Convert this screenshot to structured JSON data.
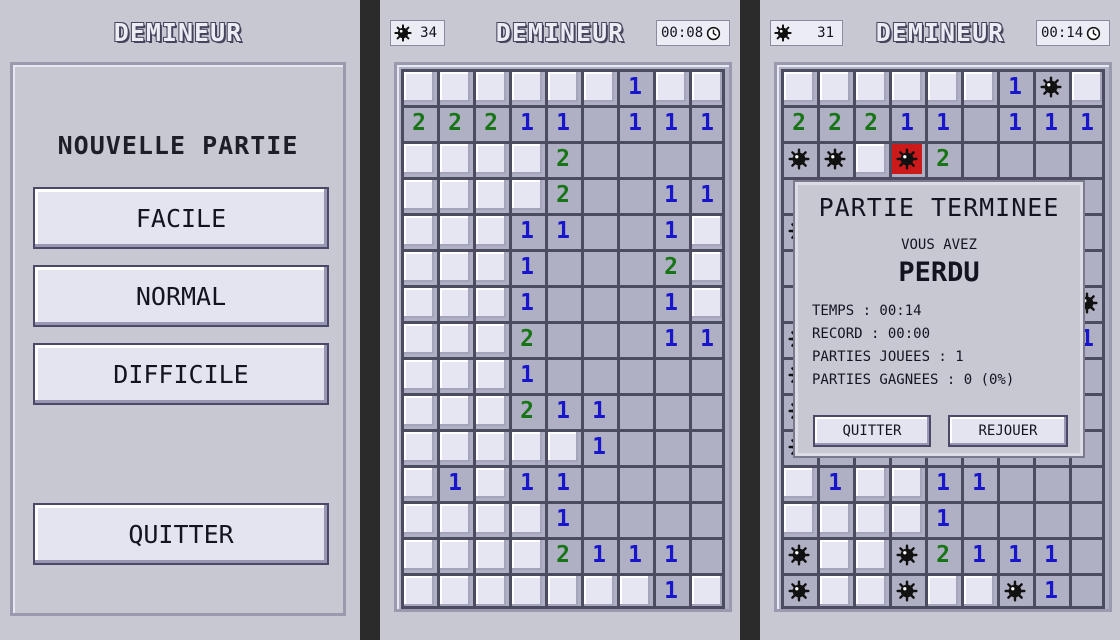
{
  "game_title": "DEMINEUR",
  "menu": {
    "heading": "NOUVELLE PARTIE",
    "buttons": [
      "FACILE",
      "NORMAL",
      "DIFFICILE"
    ],
    "quit": "QUITTER"
  },
  "game1": {
    "mines_left": "34",
    "timer": "00:08",
    "rows": [
      "HHHHHH1HH",
      "22211 111",
      "HHHH2    ",
      "HHHH2  11",
      "HHH11  1H",
      "HHH1   2H",
      "HHH1   1H",
      "HHH2   11",
      "HHH1     ",
      "HHH211   ",
      "HHHHH1   ",
      "H1H11    ",
      "HHHH1    ",
      "HHHH2111 ",
      "HHHHHHH1H"
    ]
  },
  "game2": {
    "mines_left": "31",
    "timer": "00:14",
    "rows": [
      "HHHHHH1MH",
      "22211 111",
      "MMHX2    ",
      "         ",
      "M        ",
      "         ",
      "        M",
      "M       1",
      "M        ",
      "M        ",
      "M        ",
      "H1HH11   ",
      "HHHH1    ",
      "MHHM2111 ",
      "MHHMHHM1 "
    ]
  },
  "dialog": {
    "title": "PARTIE TERMINEE",
    "subtitle": "VOUS AVEZ",
    "result": "PERDU",
    "stats": [
      "TEMPS : 00:14",
      "RECORD : 00:00",
      "PARTIES JOUEES : 1",
      "PARTIES GAGNEES : 0 (0%)"
    ],
    "quit": "QUITTER",
    "replay": "REJOUER"
  },
  "colors": {
    "num1": "#1717c9",
    "num2": "#177517",
    "exploded": "#cc1a1a"
  },
  "icons": {
    "mine": "mine-icon",
    "clock": "clock-icon"
  }
}
